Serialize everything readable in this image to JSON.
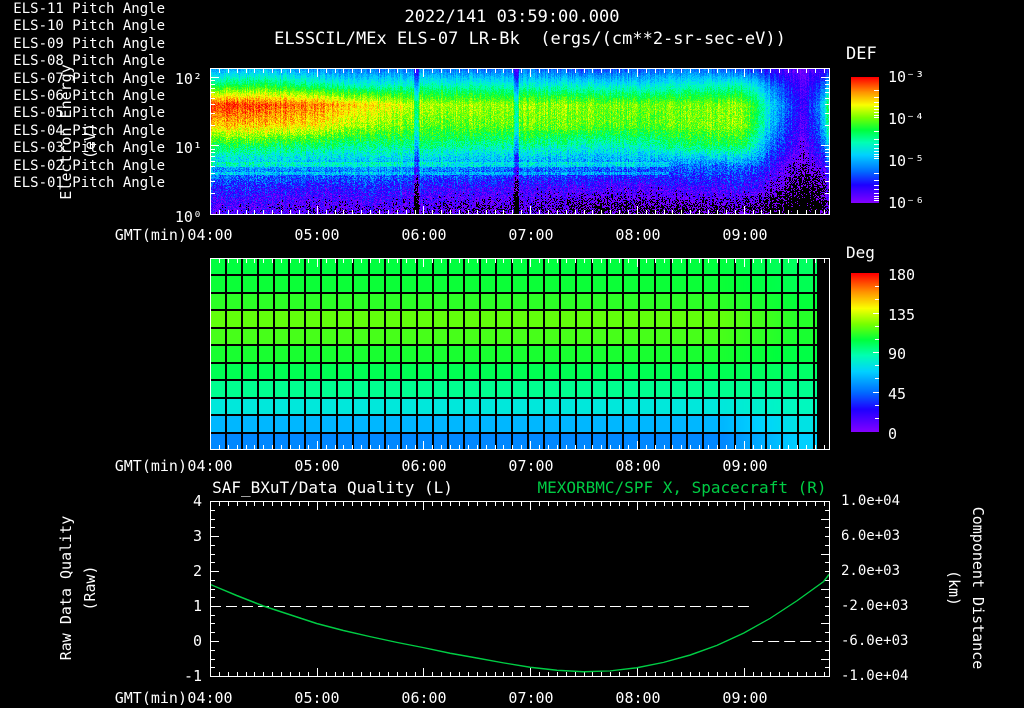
{
  "header": {
    "datetime": "2022/141 03:59:00.000"
  },
  "colors": {
    "background": "#000000",
    "text": "#ffffff",
    "frame": "#ffffff",
    "series_green": "#00cc44"
  },
  "time_axis": {
    "label": "GMT(min)",
    "ticks": [
      "04:00",
      "05:00",
      "06:00",
      "07:00",
      "08:00",
      "09:00"
    ]
  },
  "chart_data": [
    {
      "type": "heatmap",
      "title": "ELSSCIL/MEx ELS-07 LR-Bk  (ergs/(cm**2-sr-sec-eV))",
      "xlabel": "GMT(min)",
      "x_tick_labels": [
        "04:00",
        "05:00",
        "06:00",
        "07:00",
        "08:00",
        "09:00"
      ],
      "x_range_hours": [
        4.0,
        9.8
      ],
      "ylabel_line1": "Electron Energy",
      "ylabel_line2": "(eV)",
      "y_scale": "log",
      "y_ticks": [
        "10²",
        "10¹",
        "10⁰"
      ],
      "y_log_range": [
        0,
        2.13
      ],
      "colorbar": {
        "title": "DEF",
        "ticks": [
          "10⁻³",
          "10⁻⁴",
          "10⁻⁵",
          "10⁻⁶"
        ],
        "log10_range": [
          -6,
          -3
        ]
      },
      "grid_hours": [
        4.0,
        4.5,
        5.0,
        5.5,
        6.0,
        6.5,
        7.0,
        7.5,
        8.0,
        8.5,
        9.0,
        9.25,
        9.55,
        9.7,
        9.8
      ],
      "grid_energies_ev": [
        126,
        80,
        40,
        20,
        10,
        5,
        2.5,
        1.26
      ],
      "grid_log10_def": [
        [
          -5.0,
          -4.9,
          -5.1,
          -5.2,
          -5.1,
          -5.2,
          -5.2,
          -5.3,
          -5.3,
          -5.2,
          -5.3,
          -5.6,
          -5.9,
          -5.7,
          -5.5
        ],
        [
          -4.4,
          -4.3,
          -4.5,
          -4.7,
          -4.6,
          -4.6,
          -4.7,
          -4.7,
          -4.8,
          -4.7,
          -4.6,
          -5.2,
          -5.8,
          -5.5,
          -4.9
        ],
        [
          -3.1,
          -3.15,
          -3.3,
          -3.6,
          -3.8,
          -3.85,
          -3.9,
          -3.9,
          -4.0,
          -4.0,
          -3.9,
          -4.8,
          -5.7,
          -5.2,
          -4.2
        ],
        [
          -3.5,
          -3.5,
          -3.6,
          -3.9,
          -4.0,
          -4.0,
          -4.0,
          -4.0,
          -4.1,
          -4.0,
          -3.9,
          -4.9,
          -5.8,
          -5.3,
          -4.3
        ],
        [
          -4.3,
          -4.3,
          -4.4,
          -4.5,
          -4.4,
          -4.5,
          -4.5,
          -4.6,
          -4.6,
          -4.4,
          -4.3,
          -5.2,
          -5.9,
          -5.5,
          -4.8
        ],
        [
          -5.0,
          -5.0,
          -5.05,
          -5.0,
          -5.05,
          -5.1,
          -5.15,
          -5.15,
          -5.2,
          -5.3,
          -5.2,
          -5.6,
          -6.1,
          -5.9,
          -5.4
        ],
        [
          -5.5,
          -5.5,
          -5.6,
          -5.5,
          -5.6,
          -5.6,
          -5.7,
          -5.7,
          -5.8,
          -5.7,
          -5.6,
          -5.9,
          -6.3,
          -6.2,
          -5.8
        ],
        [
          -5.8,
          -5.8,
          -5.9,
          -5.9,
          -5.9,
          -6.0,
          -6.0,
          -6.1,
          -6.2,
          -6.2,
          -6.1,
          -6.3,
          -6.5,
          -6.4,
          -6.0
        ]
      ],
      "gap_hours": [
        5.93,
        6.87
      ],
      "stripe_boost_bands_logE": [
        [
          0.7,
          0.76
        ],
        [
          0.57,
          0.62
        ]
      ],
      "stripe_boost_until_hour": 8.3
    },
    {
      "type": "heatmap",
      "name": "ELS pitch angles",
      "x_range_hours": [
        4.0,
        9.8
      ],
      "rows": [
        {
          "label": "ELS-11 Pitch Angle",
          "deg_start": 104,
          "deg_end": 99
        },
        {
          "label": "ELS-10 Pitch Angle",
          "deg_start": 106,
          "deg_end": 101
        },
        {
          "label": "ELS-09 Pitch Angle",
          "deg_start": 111,
          "deg_end": 105
        },
        {
          "label": "ELS-08 Pitch Angle",
          "deg_start": 119,
          "deg_end": 110
        },
        {
          "label": "ELS-07 Pitch Angle",
          "deg_start": 115,
          "deg_end": 108
        },
        {
          "label": "ELS-06 Pitch Angle",
          "deg_start": 108,
          "deg_end": 103
        },
        {
          "label": "ELS-05 Pitch Angle",
          "deg_start": 101,
          "deg_end": 98
        },
        {
          "label": "ELS-04 Pitch Angle",
          "deg_start": 92,
          "deg_end": 92
        },
        {
          "label": "ELS-03 Pitch Angle",
          "deg_start": 77,
          "deg_end": 84
        },
        {
          "label": "ELS-02 Pitch Angle",
          "deg_start": 62,
          "deg_end": 75
        },
        {
          "label": "ELS-01 Pitch Angle",
          "deg_start": 51,
          "deg_end": 68
        }
      ],
      "transition_hours": [
        8.8,
        9.5
      ],
      "no_data_after_hour": 9.68,
      "grid_columns": 39,
      "colorbar": {
        "title": "Deg",
        "ticks": [
          "180",
          "135",
          "90",
          "45",
          "0"
        ],
        "range": [
          0,
          180
        ]
      }
    },
    {
      "type": "line",
      "title_left": "SAF_BXuT/Data Quality (L)",
      "title_right": "MEXORBMC/SPF X, Spacecraft (R)",
      "xlabel": "GMT(min)",
      "x_tick_labels": [
        "04:00",
        "05:00",
        "06:00",
        "07:00",
        "08:00",
        "09:00"
      ],
      "x_range_hours": [
        4.0,
        9.8
      ],
      "left_axis": {
        "label_line1": "Raw Data Quality",
        "label_line2": "(Raw)",
        "range": [
          -1,
          4
        ],
        "ticks": [
          "4",
          "3",
          "2",
          "1",
          "0",
          "-1"
        ]
      },
      "right_axis": {
        "label_line1": "Component Distance",
        "label_line2": "(km)",
        "range": [
          -10000,
          10000
        ],
        "ticks": [
          "1.0e+04",
          "6.0e+03",
          "2.0e+03",
          "-2.0e+03",
          "-6.0e+03",
          "-1.0e+04"
        ]
      },
      "series": [
        {
          "name": "SAF_BXuT/Data Quality",
          "axis": "left",
          "color": "#ffffff",
          "style": "dashed",
          "segments": [
            {
              "x_start": 4.0,
              "x_end": 9.05,
              "value": 1
            },
            {
              "x_start": 9.08,
              "x_end": 9.73,
              "value": 0
            }
          ]
        },
        {
          "name": "MEXORBMC/SPF X, Spacecraft",
          "axis": "right",
          "color": "#00cc44",
          "style": "solid",
          "x_hours": [
            4.0,
            4.25,
            4.5,
            4.75,
            5.0,
            5.25,
            5.5,
            5.75,
            6.0,
            6.25,
            6.5,
            6.75,
            7.0,
            7.25,
            7.5,
            7.75,
            8.0,
            8.25,
            8.5,
            8.75,
            9.0,
            9.25,
            9.5,
            9.75,
            9.8
          ],
          "y_km": [
            480,
            -800,
            -2000,
            -3000,
            -4000,
            -4800,
            -5500,
            -6150,
            -6750,
            -7400,
            -7950,
            -8500,
            -9000,
            -9350,
            -9520,
            -9420,
            -9050,
            -8450,
            -7600,
            -6500,
            -5100,
            -3400,
            -1400,
            800,
            1600
          ]
        }
      ]
    }
  ]
}
